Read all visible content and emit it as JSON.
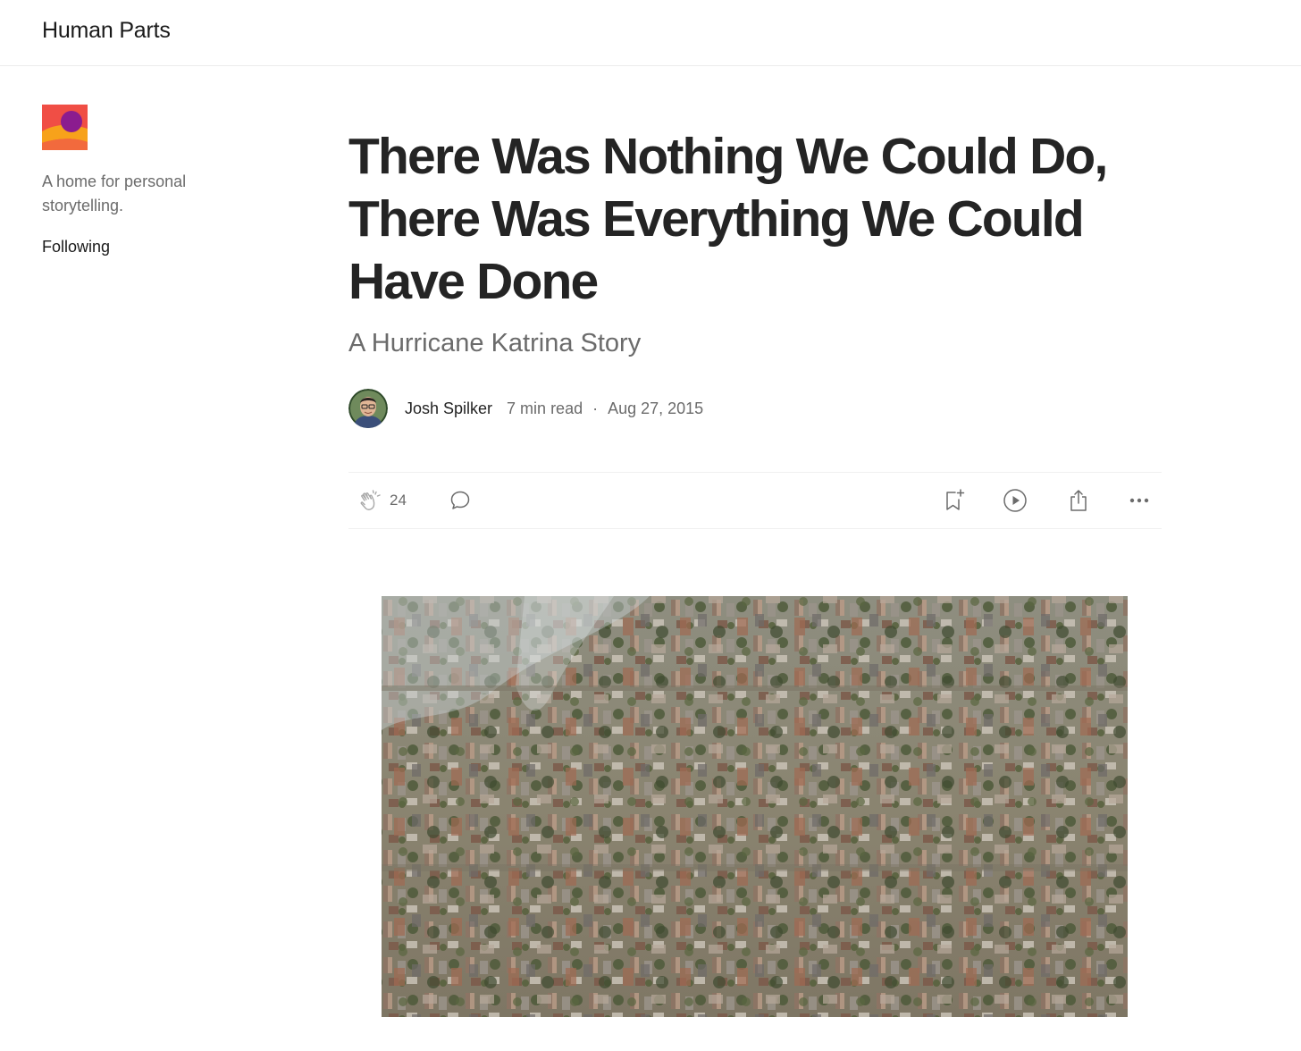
{
  "header": {
    "publication_name": "Human Parts"
  },
  "sidebar": {
    "logo_icon": "human-parts-logo",
    "description": "A home for personal storytelling.",
    "follow_label": "Following"
  },
  "article": {
    "title": "There Was Nothing We Could Do, There Was Everything We Could Have Done",
    "subtitle": "A Hurricane Katrina Story",
    "author": "Josh Spilker",
    "read_time": "7 min read",
    "separator": "·",
    "date": "Aug 27, 2015"
  },
  "actions": {
    "clap_count": "24",
    "icons": [
      "clap-icon",
      "comment-icon",
      "bookmark-add-icon",
      "play-icon",
      "share-icon",
      "more-icon"
    ]
  },
  "colors": {
    "text_primary": "#242424",
    "text_secondary": "#6b6b6b",
    "divider": "#f0f0f0",
    "logo_red": "#f04e45",
    "logo_orange": "#f7a21b",
    "logo_purple": "#8b1c8f"
  }
}
